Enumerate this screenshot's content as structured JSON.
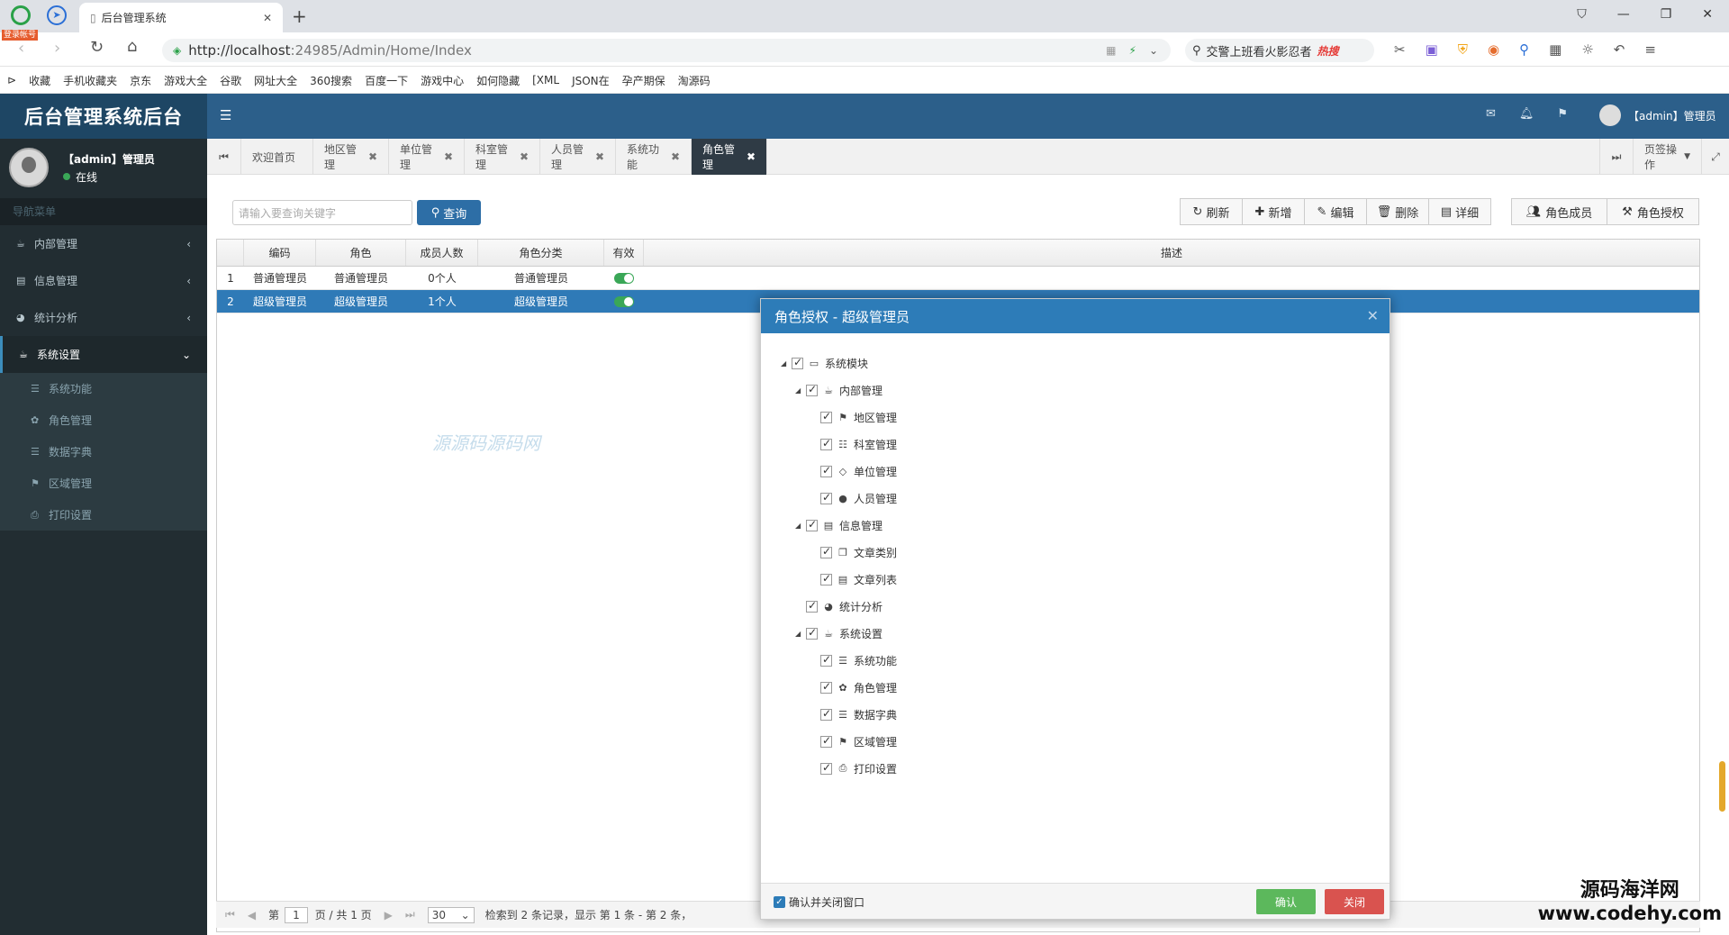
{
  "browser": {
    "badge": "登录帐号",
    "tab_title": "后台管理系统",
    "url_host": "http://localhost",
    "url_rest": ":24985/Admin/Home/Index",
    "search_text": "交警上班看火影忍者",
    "search_badge": "热搜",
    "bookmarks": [
      "收藏",
      "手机收藏夹",
      "京东",
      "游戏大全",
      "谷歌",
      "网址大全",
      "360搜索",
      "百度一下",
      "游戏中心",
      "如何隐藏",
      "[XML",
      "JSON在",
      "孕产期保",
      "淘源码"
    ]
  },
  "app": {
    "brand": "后台管理系统后台",
    "header_user": "【admin】管理员",
    "user_name": "【admin】管理员",
    "user_status": "在线",
    "nav_heading": "导航菜单",
    "nav": [
      {
        "label": "内部管理",
        "chev": "‹"
      },
      {
        "label": "信息管理",
        "chev": "‹"
      },
      {
        "label": "统计分析",
        "chev": "‹"
      },
      {
        "label": "系统设置",
        "chev": "⌄"
      }
    ],
    "subnav": [
      "系统功能",
      "角色管理",
      "数据字典",
      "区域管理",
      "打印设置"
    ]
  },
  "page_tabs": [
    "欢迎首页",
    "地区管理",
    "单位管理",
    "科室管理",
    "人员管理",
    "系统功能",
    "角色管理"
  ],
  "page_tab_ops": "页签操作",
  "toolbar": {
    "search_placeholder": "请输入要查询关键字",
    "query": "查询",
    "refresh": "刷新",
    "add": "新增",
    "edit": "编辑",
    "delete": "删除",
    "detail": "详细",
    "members": "角色成员",
    "authorize": "角色授权"
  },
  "grid": {
    "columns": [
      "编码",
      "角色",
      "成员人数",
      "角色分类",
      "有效",
      "描述"
    ],
    "rows": [
      {
        "no": "1",
        "code": "普通管理员",
        "role": "普通管理员",
        "count": "0个人",
        "category": "普通管理员"
      },
      {
        "no": "2",
        "code": "超级管理员",
        "role": "超级管理员",
        "count": "1个人",
        "category": "超级管理员"
      }
    ]
  },
  "pager": {
    "page_label": "第",
    "page": "1",
    "total": "页 / 共 1 页",
    "size": "30",
    "info": "检索到 2 条记录，显示 第 1 条 - 第 2 条，"
  },
  "watermark": "源源码源码网",
  "modal": {
    "title": "角色授权 - 超级管理员",
    "tree": [
      {
        "label": "系统模块",
        "level": 0,
        "icon": "▭",
        "arrow": "◢"
      },
      {
        "label": "内部管理",
        "level": 1,
        "icon": "☕",
        "arrow": "◢"
      },
      {
        "label": "地区管理",
        "level": 2,
        "icon": "⚑",
        "arrow": ""
      },
      {
        "label": "科室管理",
        "level": 2,
        "icon": "☷",
        "arrow": ""
      },
      {
        "label": "单位管理",
        "level": 2,
        "icon": "◇",
        "arrow": ""
      },
      {
        "label": "人员管理",
        "level": 2,
        "icon": "●",
        "arrow": ""
      },
      {
        "label": "信息管理",
        "level": 1,
        "icon": "▤",
        "arrow": "◢"
      },
      {
        "label": "文章类别",
        "level": 2,
        "icon": "❐",
        "arrow": ""
      },
      {
        "label": "文章列表",
        "level": 2,
        "icon": "▤",
        "arrow": ""
      },
      {
        "label": "统计分析",
        "level": 1,
        "icon": "◕",
        "arrow": ""
      },
      {
        "label": "系统设置",
        "level": 1,
        "icon": "☕",
        "arrow": "◢"
      },
      {
        "label": "系统功能",
        "level": 2,
        "icon": "☰",
        "arrow": ""
      },
      {
        "label": "角色管理",
        "level": 2,
        "icon": "✿",
        "arrow": ""
      },
      {
        "label": "数据字典",
        "level": 2,
        "icon": "☰",
        "arrow": ""
      },
      {
        "label": "区域管理",
        "level": 2,
        "icon": "⚑",
        "arrow": ""
      },
      {
        "label": "打印设置",
        "level": 2,
        "icon": "⎙",
        "arrow": ""
      }
    ],
    "confirm_close_label": "确认并关闭窗口",
    "confirm": "确认",
    "close": "关闭"
  },
  "corner": {
    "line1": "源码海洋网",
    "line2": "www.codehy.com"
  },
  "colors": {
    "header": "#2c5f8a",
    "sidebar": "#222d32",
    "modal_title": "#2d7cb8",
    "confirm": "#5cb85c",
    "close": "#d9534f",
    "toggle": "#3aa757"
  }
}
